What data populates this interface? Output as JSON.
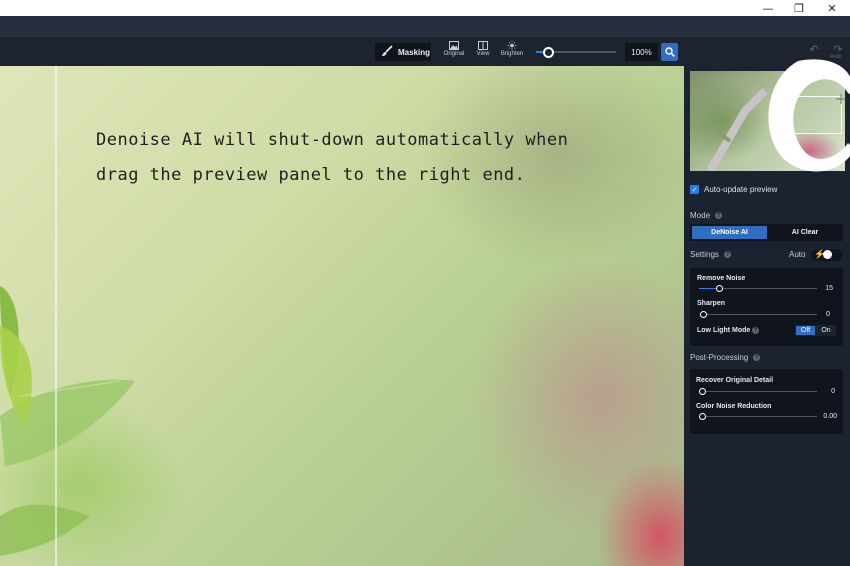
{
  "window": {
    "minimize": "—",
    "restore": "❐",
    "close": "✕"
  },
  "toolbar": {
    "masking": "Masking",
    "original": "Original",
    "view": "View",
    "brighten": "Brighten",
    "zoom": "100%",
    "redo_label": "Redo"
  },
  "overlay": {
    "line1": "Denoise AI will shut-down automatically when",
    "line2": "drag the preview panel to the right end."
  },
  "panel": {
    "auto_update": "Auto-update preview",
    "mode_label": "Mode",
    "modes": [
      "DeNoise AI",
      "AI Clear"
    ],
    "settings_label": "Settings",
    "auto_label": "Auto",
    "remove_noise": {
      "label": "Remove Noise",
      "value": "15"
    },
    "sharpen": {
      "label": "Sharpen",
      "value": "0"
    },
    "low_light": {
      "label": "Low Light Mode",
      "off": "Off",
      "on": "On"
    },
    "post_label": "Post-Processing",
    "recover": {
      "label": "Recover Original Detail",
      "value": "0"
    },
    "color_noise": {
      "label": "Color Noise Reduction",
      "value": "0.00"
    }
  },
  "colors": {
    "accent": "#2f6ec0",
    "panel": "#1b2230"
  }
}
